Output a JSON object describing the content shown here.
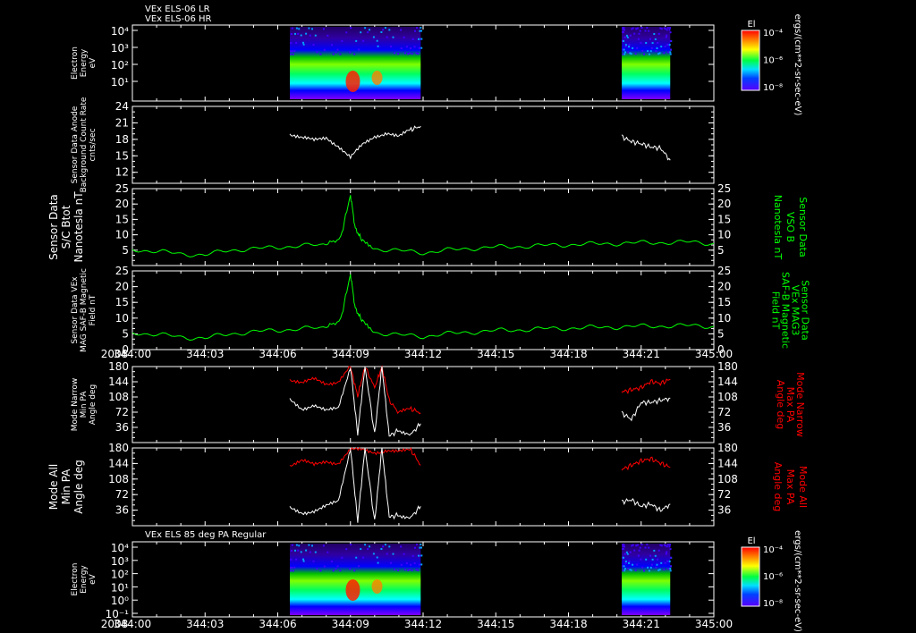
{
  "chart_data": [
    {
      "type": "heatmap",
      "panel": 1,
      "title": "VEx ELS-06 LR",
      "subtitle": "VEx ELS-06 HR",
      "ylabel": "Electron Energy eV",
      "yscale": "log",
      "ylim": [
        1,
        20000
      ],
      "yticks": [
        "10⁴",
        "10³",
        "10²",
        "10¹"
      ],
      "colorbar": {
        "label": "El",
        "unit": "ergs/(cm**2-sr-sec-eV)",
        "ticks": [
          "10⁻⁴",
          "10⁻⁶",
          "10⁻⁸"
        ]
      },
      "segments": [
        {
          "start": "344:06.5",
          "end": "344:11.9"
        },
        {
          "start": "344:20.2",
          "end": "344:22.2"
        }
      ]
    },
    {
      "type": "line",
      "panel": 2,
      "ylabel": "Sensor Data Anode Background Count Rate cnts/sec",
      "ylim": [
        10,
        24
      ],
      "yticks": [
        12,
        15,
        18,
        21,
        24
      ],
      "series": [
        {
          "color": "#ffffff",
          "x": [
            6.5,
            7.0,
            7.5,
            8.0,
            8.5,
            9.0,
            9.5,
            10.0,
            10.5,
            11.0,
            11.5,
            11.9
          ],
          "y": [
            19,
            18.2,
            17.8,
            18.4,
            16.8,
            14.6,
            17.0,
            18.6,
            19.2,
            18.4,
            19.8,
            20.4
          ]
        },
        {
          "color": "#ffffff",
          "x": [
            20.2,
            20.6,
            21.0,
            21.4,
            21.8,
            22.2
          ],
          "y": [
            18.5,
            17.6,
            17.2,
            16.6,
            16.4,
            14.2
          ]
        }
      ]
    },
    {
      "type": "line",
      "panel": 3,
      "ylabel": "Sensor Data S/C Btot Nanotesla nT",
      "ylabel_right": "Sensor Data VSO B Nanotesla nT",
      "ylim": [
        0,
        25
      ],
      "yticks": [
        5,
        10,
        15,
        20,
        25
      ],
      "series": [
        {
          "color": "#00ff00",
          "x": [
            0,
            1,
            2,
            3,
            4,
            5,
            6,
            7,
            8,
            8.6,
            9.0,
            9.2,
            9.5,
            10.0,
            11,
            12,
            13,
            14,
            15,
            16,
            17,
            18,
            19,
            20,
            21,
            22,
            23,
            24
          ],
          "y": [
            5.2,
            4.6,
            3.8,
            3.4,
            5.0,
            5.4,
            6.0,
            6.4,
            6.8,
            9.0,
            23.0,
            12.0,
            8.0,
            5.5,
            4.8,
            4.2,
            5.0,
            5.6,
            6.0,
            6.2,
            6.5,
            6.8,
            7.0,
            7.2,
            7.4,
            7.5,
            7.6,
            7.2
          ]
        }
      ]
    },
    {
      "type": "line",
      "panel": 4,
      "ylabel": "Sensor Data VEx MAG SAF-B Magnetic Field nT",
      "ylabel_right": "Sensor Data VEx MAG3 SAF-B Magnetic Field nT",
      "ylim": [
        0,
        25
      ],
      "yticks": [
        0,
        5,
        10,
        15,
        20,
        25
      ],
      "series": [
        {
          "color": "#00ff00",
          "x": [
            0,
            1,
            2,
            3,
            4,
            5,
            6,
            7,
            8,
            8.6,
            9.0,
            9.2,
            9.5,
            10.0,
            11,
            12,
            13,
            14,
            15,
            16,
            17,
            18,
            19,
            20,
            21,
            22,
            23,
            24
          ],
          "y": [
            5.4,
            4.8,
            4.0,
            3.6,
            5.0,
            5.6,
            6.2,
            6.6,
            7.0,
            9.5,
            24.0,
            13.0,
            9.0,
            5.5,
            4.6,
            4.2,
            5.0,
            5.6,
            6.0,
            6.3,
            6.6,
            6.8,
            7.0,
            7.2,
            7.4,
            7.5,
            7.6,
            7.4
          ]
        }
      ]
    },
    {
      "type": "line",
      "panel": 5,
      "ylabel": "Mode Narrow Min PA Angle deg",
      "ylabel_right": "Mode Narrow Max PA Angle deg",
      "ylim": [
        0,
        180
      ],
      "yticks": [
        36,
        72,
        108,
        144,
        180
      ],
      "series": [
        {
          "color": "#ff0000",
          "x": [
            6.5,
            7.0,
            7.5,
            8.0,
            8.5,
            9.0,
            9.3,
            9.6,
            10.0,
            10.3,
            10.6,
            11.0,
            11.5,
            11.9
          ],
          "y": [
            150,
            140,
            150,
            140,
            145,
            180,
            110,
            180,
            130,
            180,
            100,
            70,
            80,
            70
          ]
        },
        {
          "color": "#ffffff",
          "x": [
            6.5,
            7.0,
            7.5,
            8.0,
            8.5,
            9.0,
            9.3,
            9.6,
            10.0,
            10.3,
            10.6,
            11.0,
            11.5,
            11.9
          ],
          "y": [
            100,
            80,
            90,
            75,
            80,
            180,
            20,
            180,
            20,
            180,
            15,
            30,
            20,
            45
          ]
        },
        {
          "color": "#ff0000",
          "x": [
            20.2,
            20.6,
            21.0,
            21.4,
            21.8,
            22.2
          ],
          "y": [
            120,
            125,
            130,
            145,
            140,
            150
          ]
        },
        {
          "color": "#ffffff",
          "x": [
            20.2,
            20.6,
            21.0,
            21.4,
            21.8,
            22.2
          ],
          "y": [
            70,
            55,
            95,
            95,
            100,
            105
          ]
        }
      ]
    },
    {
      "type": "line",
      "panel": 6,
      "ylabel": "Mode All Min PA Angle deg",
      "ylabel_right": "Mode All Max PA Angle deg",
      "ylim": [
        0,
        180
      ],
      "yticks": [
        36,
        72,
        108,
        144,
        180
      ],
      "series": [
        {
          "color": "#ff0000",
          "x": [
            6.5,
            7.0,
            7.5,
            8.0,
            8.5,
            9.0,
            9.5,
            10.0,
            10.5,
            11.0,
            11.5,
            11.9
          ],
          "y": [
            140,
            150,
            140,
            150,
            145,
            175,
            175,
            170,
            175,
            170,
            175,
            140
          ]
        },
        {
          "color": "#ffffff",
          "x": [
            6.5,
            7.0,
            7.5,
            8.0,
            8.5,
            9.0,
            9.3,
            9.6,
            10.0,
            10.3,
            10.6,
            11.0,
            11.5,
            11.9
          ],
          "y": [
            40,
            30,
            35,
            45,
            55,
            180,
            10,
            180,
            10,
            180,
            20,
            25,
            20,
            45
          ]
        },
        {
          "color": "#ff0000",
          "x": [
            20.2,
            20.6,
            21.0,
            21.4,
            21.8,
            22.2
          ],
          "y": [
            130,
            140,
            150,
            155,
            145,
            135
          ]
        },
        {
          "color": "#ffffff",
          "x": [
            20.2,
            20.6,
            21.0,
            21.4,
            21.8,
            22.2
          ],
          "y": [
            55,
            60,
            45,
            50,
            35,
            50
          ]
        }
      ]
    },
    {
      "type": "heatmap",
      "panel": 7,
      "title": "VEx ELS 85 deg PA Regular",
      "ylabel": "Electron Energy eV",
      "yscale": "log",
      "ylim": [
        1,
        20000
      ],
      "yticks": [
        "10⁴",
        "10³",
        "10²",
        "10¹",
        "10⁰",
        "10⁻¹"
      ],
      "colorbar": {
        "label": "El",
        "unit": "ergs/(cm**2-sr-sec-eV)",
        "ticks": [
          "10⁻⁴",
          "10⁻⁶",
          "10⁻⁸"
        ]
      },
      "segments": [
        {
          "start": "344:06.5",
          "end": "344:11.9"
        },
        {
          "start": "344:20.2",
          "end": "344:22.2"
        }
      ]
    }
  ],
  "xaxis": {
    "year": "2008",
    "labels": [
      "344:00",
      "344:03",
      "344:06",
      "344:09",
      "344:12",
      "344:15",
      "344:18",
      "344:21",
      "345:00"
    ]
  }
}
